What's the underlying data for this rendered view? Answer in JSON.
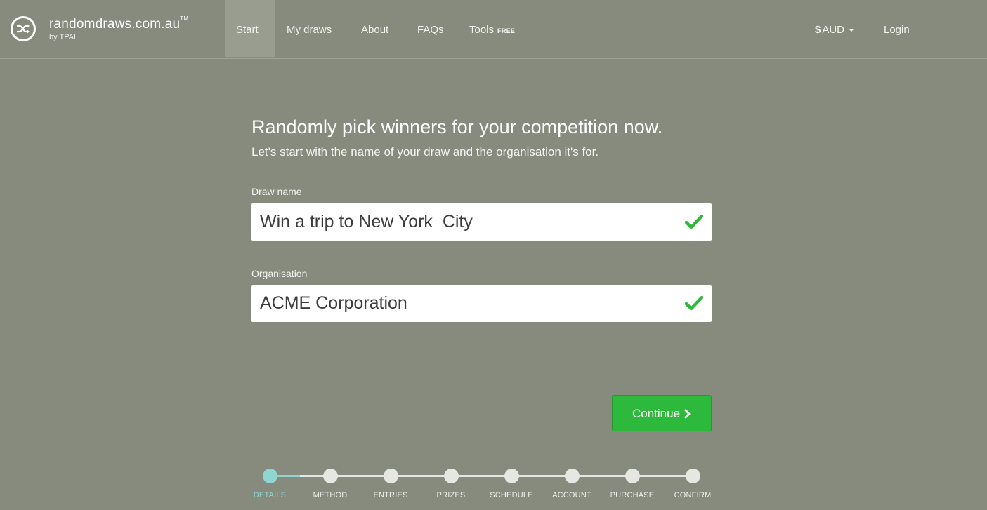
{
  "header": {
    "brand": "randomdraws.com.au",
    "brand_tm": "TM",
    "brand_sub": "by TPAL",
    "nav": [
      {
        "label": "Start",
        "active": true
      },
      {
        "label": "My draws",
        "active": false
      },
      {
        "label": "About",
        "active": false
      },
      {
        "label": "FAQs",
        "active": false
      },
      {
        "label": "Tools",
        "badge": "FREE",
        "active": false
      }
    ],
    "currency_symbol": "$",
    "currency_code": "AUD",
    "login": "Login"
  },
  "main": {
    "title": "Randomly pick winners for your competition now.",
    "subtitle": "Let's start with the name of your draw and the organisation it's for.",
    "draw_name": {
      "label": "Draw name",
      "value": "Win a trip to New York  City",
      "valid": true
    },
    "organisation": {
      "label": "Organisation",
      "value": "ACME Corporation",
      "valid": true
    },
    "continue_label": "Continue"
  },
  "stepper": {
    "steps": [
      "DETAILS",
      "METHOD",
      "ENTRIES",
      "PRIZES",
      "SCHEDULE",
      "ACCOUNT",
      "PURCHASE",
      "CONFIRM"
    ],
    "current_index": 0
  },
  "colors": {
    "background": "#878b7e",
    "accent_green": "#2db93c",
    "step_active": "#8fd6d3",
    "step_inactive": "#e6e6e2"
  }
}
